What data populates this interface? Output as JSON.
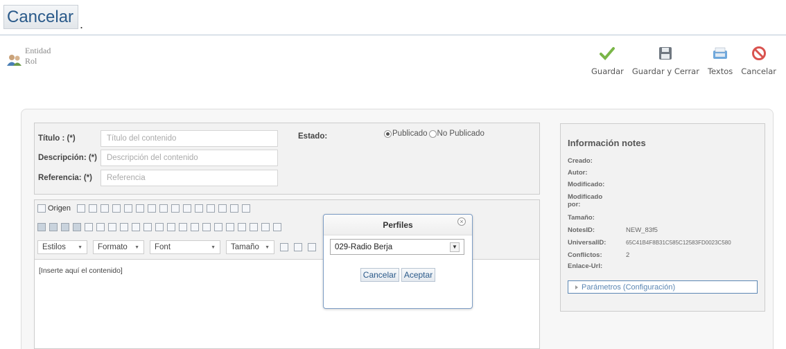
{
  "top_button": {
    "label": "Cancelar",
    "trailing": "."
  },
  "entity": {
    "line1": "Entidad",
    "line2": "Rol"
  },
  "toolbar": {
    "guardar": "Guardar",
    "guardar_cerrar": "Guardar y Cerrar",
    "textos": "Textos",
    "cancelar": "Cancelar"
  },
  "form": {
    "titulo_label": "Título : (*)",
    "titulo_placeholder": "Título del contenido",
    "descripcion_label": "Descripción: (*)",
    "descripcion_placeholder": "Descripción del contenido",
    "referencia_label": "Referencia: (*)",
    "referencia_placeholder": "Referencia",
    "estado_label": "Estado:",
    "publicado": "Publicado",
    "no_publicado": "No Publicado",
    "estado_selected": "Publicado"
  },
  "editor": {
    "origen": "Origen",
    "estilos": "Estilos",
    "formato": "Formato",
    "font": "Font",
    "tamano": "Tamaño",
    "content": "[Inserte aquí el contenido]"
  },
  "info": {
    "title": "Información notes",
    "creado_label": "Creado:",
    "autor_label": "Autor:",
    "modificado_label": "Modificado:",
    "modificado_por_label": "Modificado por:",
    "tamano_label": "Tamaño:",
    "notesid_label": "NotesID:",
    "notesid_value": "NEW_83f5",
    "universalid_label": "UniversalID:",
    "universalid_value": "65C41B4F8B31C585C12583FD0023C580",
    "conflictos_label": "Conflictos:",
    "conflictos_value": "2",
    "enlace_label": "Enlace-Url:",
    "parametros": "Parámetros (Configuración)"
  },
  "dialog": {
    "title": "Perfiles",
    "selected": "029-Radio Berja",
    "cancel": "Cancelar",
    "accept": "Aceptar"
  },
  "colors": {
    "accent": "#2a5a8a",
    "check": "#7ab648",
    "cancel_red": "#d9534f",
    "link_blue": "#5b86b3"
  }
}
